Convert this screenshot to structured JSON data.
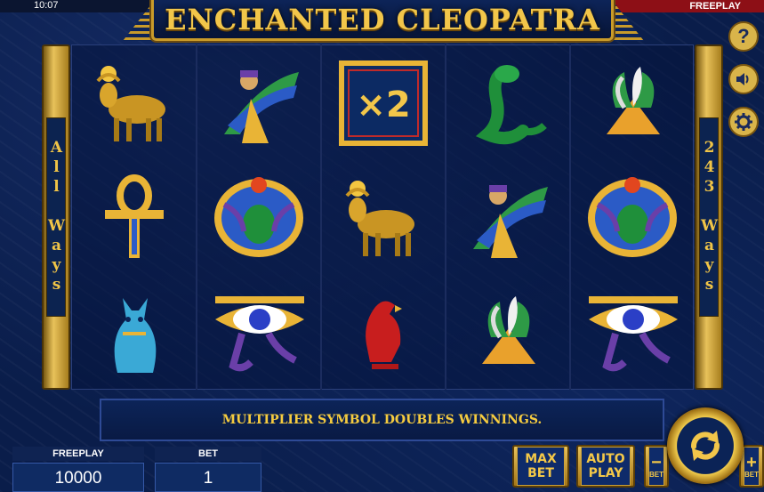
{
  "status_bar": {
    "time": "10:07",
    "mode": "FREEPLAY"
  },
  "title": "ENCHANTED CLEOPATRA",
  "side_left": "All Ways",
  "side_right": "243 Ways",
  "reels": [
    [
      "hathor-bull",
      "isis",
      "x2-multiplier",
      "cobra",
      "lotus"
    ],
    [
      "ankh",
      "scarab",
      "hathor-bull",
      "isis",
      "scarab"
    ],
    [
      "bastet-cat",
      "eye-of-horus",
      "falcon",
      "lotus",
      "eye-of-horus"
    ]
  ],
  "multiplier_label": "×2",
  "message": "MULTIPLIER SYMBOL DOUBLES WINNINGS.",
  "counters": {
    "freeplay": {
      "label": "FREEPLAY",
      "value": "10000"
    },
    "bet": {
      "label": "BET",
      "value": "1"
    }
  },
  "buttons": {
    "max_bet": "MAX\nBET",
    "auto_play": "AUTO\nPLAY",
    "minus_sym": "−",
    "minus_sub": "BET",
    "plus_sym": "+",
    "plus_sub": "BET"
  },
  "tools": {
    "help": "?"
  },
  "colors": {
    "gold": "#f2c64a",
    "panel": "#0c2350",
    "freeplay_tag": "#8d0f16"
  }
}
